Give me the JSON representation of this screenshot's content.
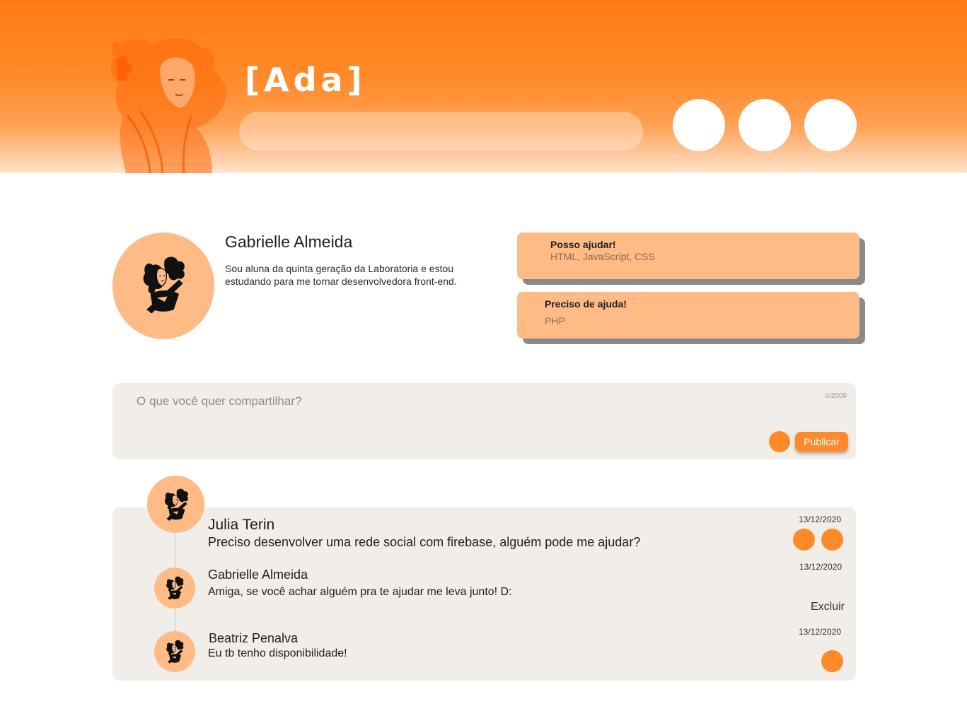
{
  "header": {
    "logo": "[Ada]",
    "search": {
      "value": "",
      "placeholder": ""
    }
  },
  "profile": {
    "name": "Gabrielle Almeida",
    "bio": "Sou aluna da quinta geração da Laboratoria e estou estudando para me tornar desenvolvedora front-end."
  },
  "skills": [
    {
      "title": "Posso ajudar!",
      "text": "HTML, JavaScript, CSS"
    },
    {
      "title": "Preciso de ajuda!",
      "text": "PHP"
    }
  ],
  "composer": {
    "value": "",
    "placeholder": "O que você quer compartilhar?",
    "char_count": "0/2000",
    "publish_label": "Publicar"
  },
  "thread": {
    "post": {
      "author": "Julia Terin",
      "text": "Preciso desenvolver uma rede social com firebase, alguém pode me ajudar?",
      "date": "13/12/2020"
    },
    "comments": [
      {
        "author": "Gabrielle Almeida",
        "text": "Amiga, se você achar alguém pra te ajudar me leva junto! D:",
        "date": "13/12/2020",
        "delete_label": "Excluir"
      },
      {
        "author": "Beatriz Penalva",
        "text": "Eu tb tenho disponibilidade!",
        "date": "13/12/2020"
      }
    ]
  },
  "colors": {
    "accent": "#ff8a2a",
    "header_top": "#ff7a12",
    "card": "#ffbb85",
    "panel": "#f1ede8",
    "card_shadow": "#8a8a8a"
  }
}
